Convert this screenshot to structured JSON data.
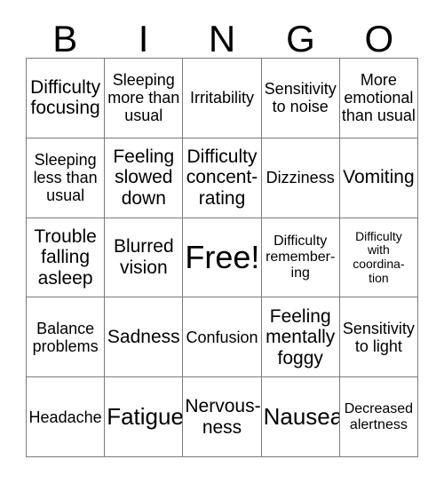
{
  "card": {
    "title_letters": [
      "B",
      "I",
      "N",
      "G",
      "O"
    ],
    "columns": 5,
    "rows": 5,
    "border_color": "#7b7b7b",
    "background_color": "#ffffff",
    "text_color": "#000000",
    "cells": [
      {
        "text": "Difficulty\nfocusing",
        "size": "md",
        "row": 1,
        "col": 1
      },
      {
        "text": "Sleeping\nmore than\nusual",
        "size": "sm",
        "row": 1,
        "col": 2
      },
      {
        "text": "Irritability",
        "size": "sm",
        "row": 1,
        "col": 3
      },
      {
        "text": "Sensitivity\nto noise",
        "size": "sm",
        "row": 1,
        "col": 4
      },
      {
        "text": "More\nemotional\nthan usual",
        "size": "sm",
        "row": 1,
        "col": 5
      },
      {
        "text": "Sleeping\nless than\nusual",
        "size": "sm",
        "row": 2,
        "col": 1
      },
      {
        "text": "Feeling\nslowed\ndown",
        "size": "md",
        "row": 2,
        "col": 2
      },
      {
        "text": "Difficulty\nconcent-\nrating",
        "size": "md",
        "row": 2,
        "col": 3
      },
      {
        "text": "Dizziness",
        "size": "sm",
        "row": 2,
        "col": 4
      },
      {
        "text": "Vomiting",
        "size": "md",
        "row": 2,
        "col": 5
      },
      {
        "text": "Trouble\nfalling\nasleep",
        "size": "md",
        "row": 3,
        "col": 1
      },
      {
        "text": "Blurred\nvision",
        "size": "md",
        "row": 3,
        "col": 2
      },
      {
        "text": "Free!",
        "size": "xl",
        "row": 3,
        "col": 3
      },
      {
        "text": "Difficulty\nremember-\ning",
        "size": "xs",
        "row": 3,
        "col": 4
      },
      {
        "text": "Difficulty\nwith\ncoordina-\ntion",
        "size": "xxs",
        "row": 3,
        "col": 5
      },
      {
        "text": "Balance\nproblems",
        "size": "sm",
        "row": 4,
        "col": 1
      },
      {
        "text": "Sadness",
        "size": "md",
        "row": 4,
        "col": 2
      },
      {
        "text": "Confusion",
        "size": "sm",
        "row": 4,
        "col": 3
      },
      {
        "text": "Feeling\nmentally\nfoggy",
        "size": "md",
        "row": 4,
        "col": 4
      },
      {
        "text": "Sensitivity\nto light",
        "size": "sm",
        "row": 4,
        "col": 5
      },
      {
        "text": "Headache",
        "size": "sm",
        "row": 5,
        "col": 1
      },
      {
        "text": "Fatigue",
        "size": "lg",
        "row": 5,
        "col": 2
      },
      {
        "text": "Nervous-\nness",
        "size": "md",
        "row": 5,
        "col": 3
      },
      {
        "text": "Nausea",
        "size": "lg",
        "row": 5,
        "col": 4
      },
      {
        "text": "Decreased\nalertness",
        "size": "xs",
        "row": 5,
        "col": 5
      }
    ]
  }
}
